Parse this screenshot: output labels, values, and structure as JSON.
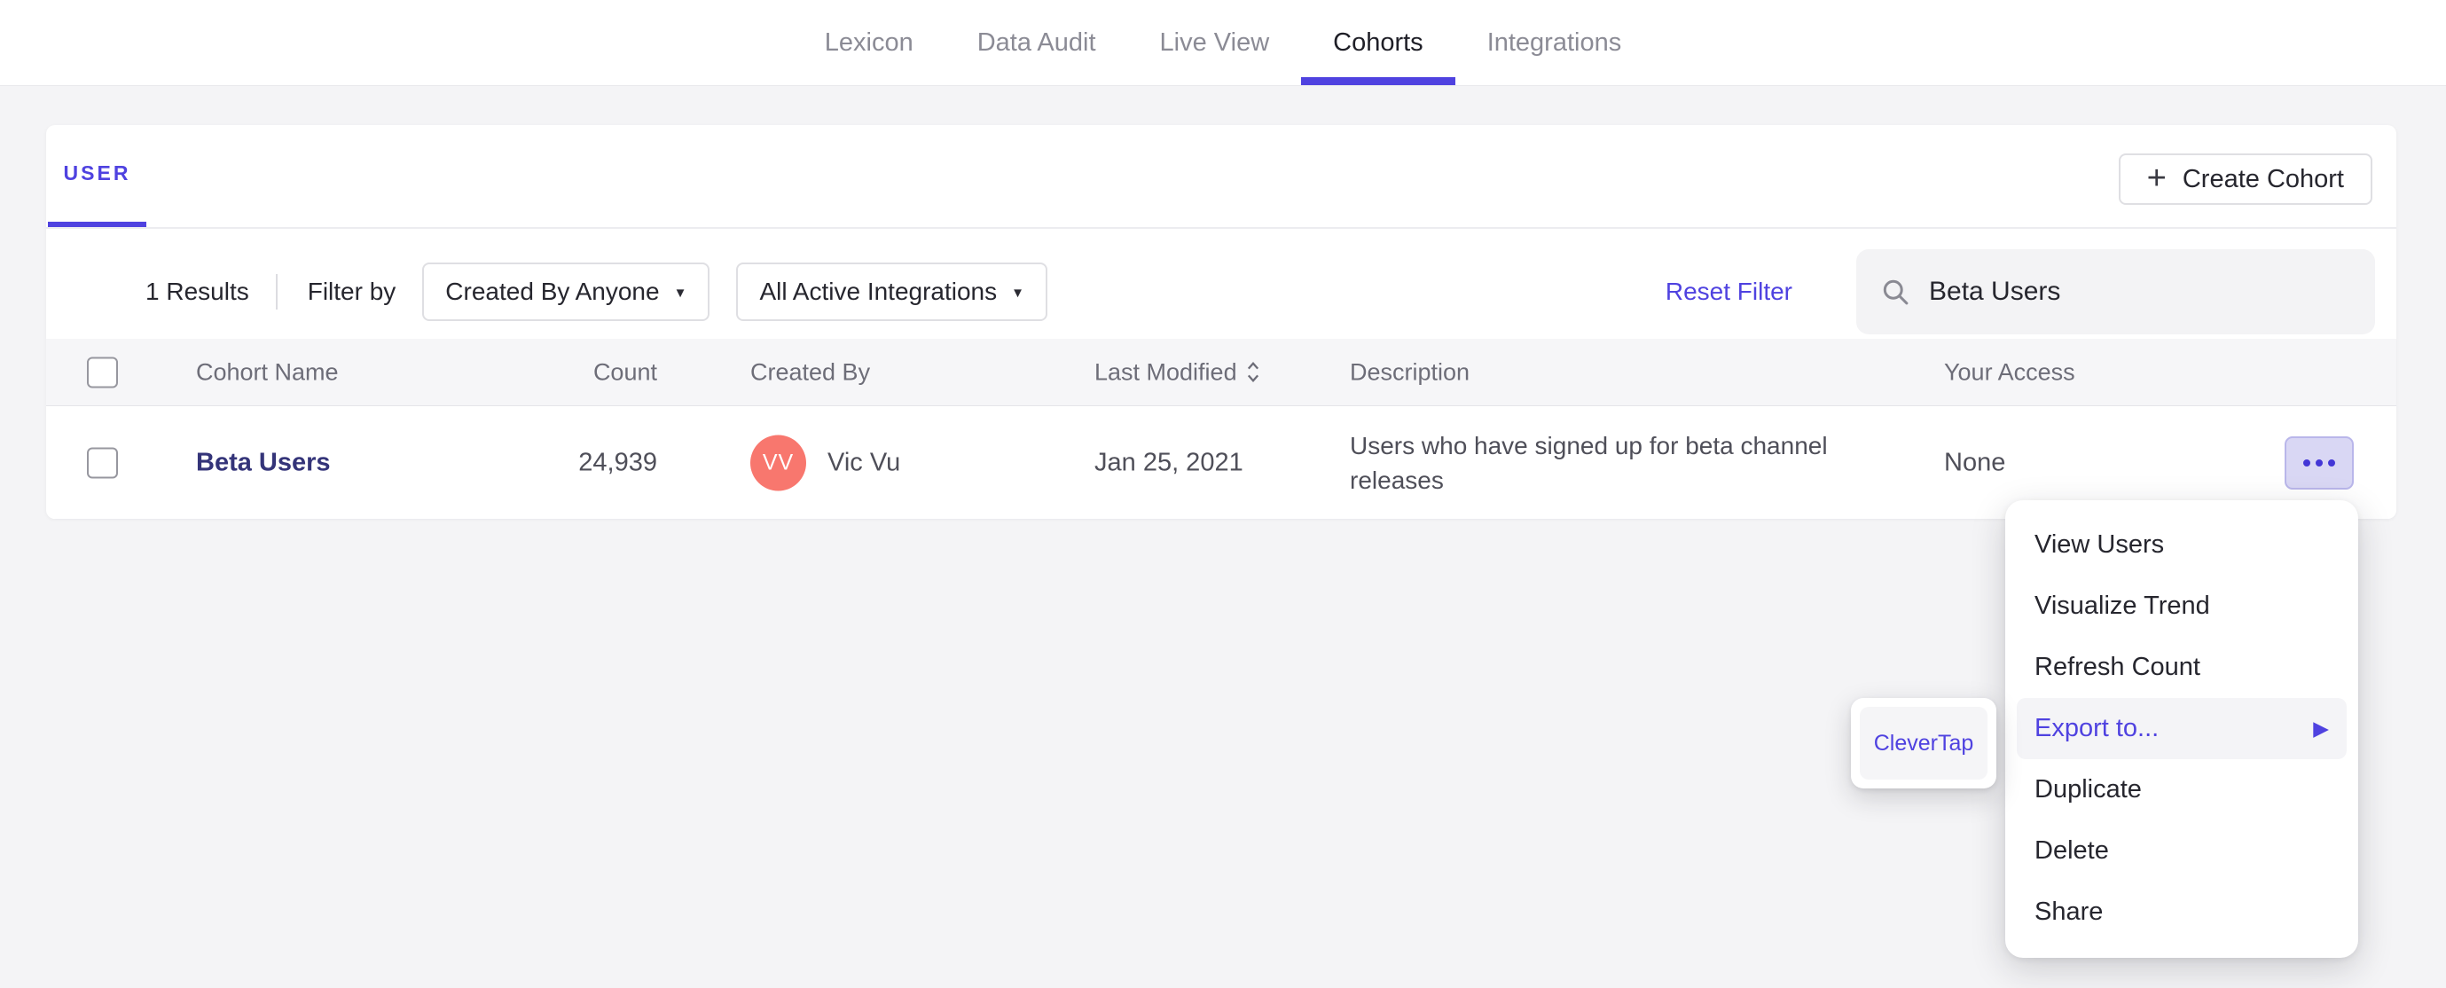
{
  "nav": {
    "tabs": [
      {
        "label": "Lexicon",
        "active": false
      },
      {
        "label": "Data Audit",
        "active": false
      },
      {
        "label": "Live View",
        "active": false
      },
      {
        "label": "Cohorts",
        "active": true
      },
      {
        "label": "Integrations",
        "active": false
      }
    ]
  },
  "panel": {
    "tab_label": "USER",
    "create_button": {
      "plus_icon": "+",
      "label": "Create Cohort"
    },
    "filters": {
      "results_count": "1 Results",
      "filter_by_label": "Filter by",
      "created_by_dropdown": {
        "value": "Created By Anyone",
        "caret_icon": "▼"
      },
      "integrations_dropdown": {
        "value": "All Active Integrations",
        "caret_icon": "▼"
      },
      "reset_filter_label": "Reset Filter",
      "search": {
        "value": "Beta Users",
        "icon": "search-icon"
      }
    },
    "table": {
      "columns": {
        "name": "Cohort Name",
        "count": "Count",
        "created_by": "Created By",
        "last_modified": "Last Modified",
        "description": "Description",
        "access": "Your Access"
      },
      "rows": [
        {
          "name": "Beta Users",
          "count": "24,939",
          "created_by": {
            "avatar_initials": "VV",
            "name": "Vic Vu",
            "avatar_color": "#f8776e"
          },
          "last_modified": "Jan 25, 2021",
          "description": "Users who have signed up for beta channel releases",
          "access": "None"
        }
      ]
    }
  },
  "context_menu": {
    "items": [
      {
        "label": "View Users"
      },
      {
        "label": "Visualize Trend"
      },
      {
        "label": "Refresh Count"
      },
      {
        "label": "Export to...",
        "highlighted": true,
        "arrow_icon": "▶"
      },
      {
        "label": "Duplicate"
      },
      {
        "label": "Delete"
      },
      {
        "label": "Share"
      }
    ]
  },
  "submenu": {
    "items": [
      {
        "label": "CleverTap"
      }
    ]
  },
  "colors": {
    "accent_purple": "#4f42e0",
    "row_link_navy": "#343479",
    "avatar_coral": "#f8776e",
    "more_button_lavender": "#d9d7f4"
  }
}
